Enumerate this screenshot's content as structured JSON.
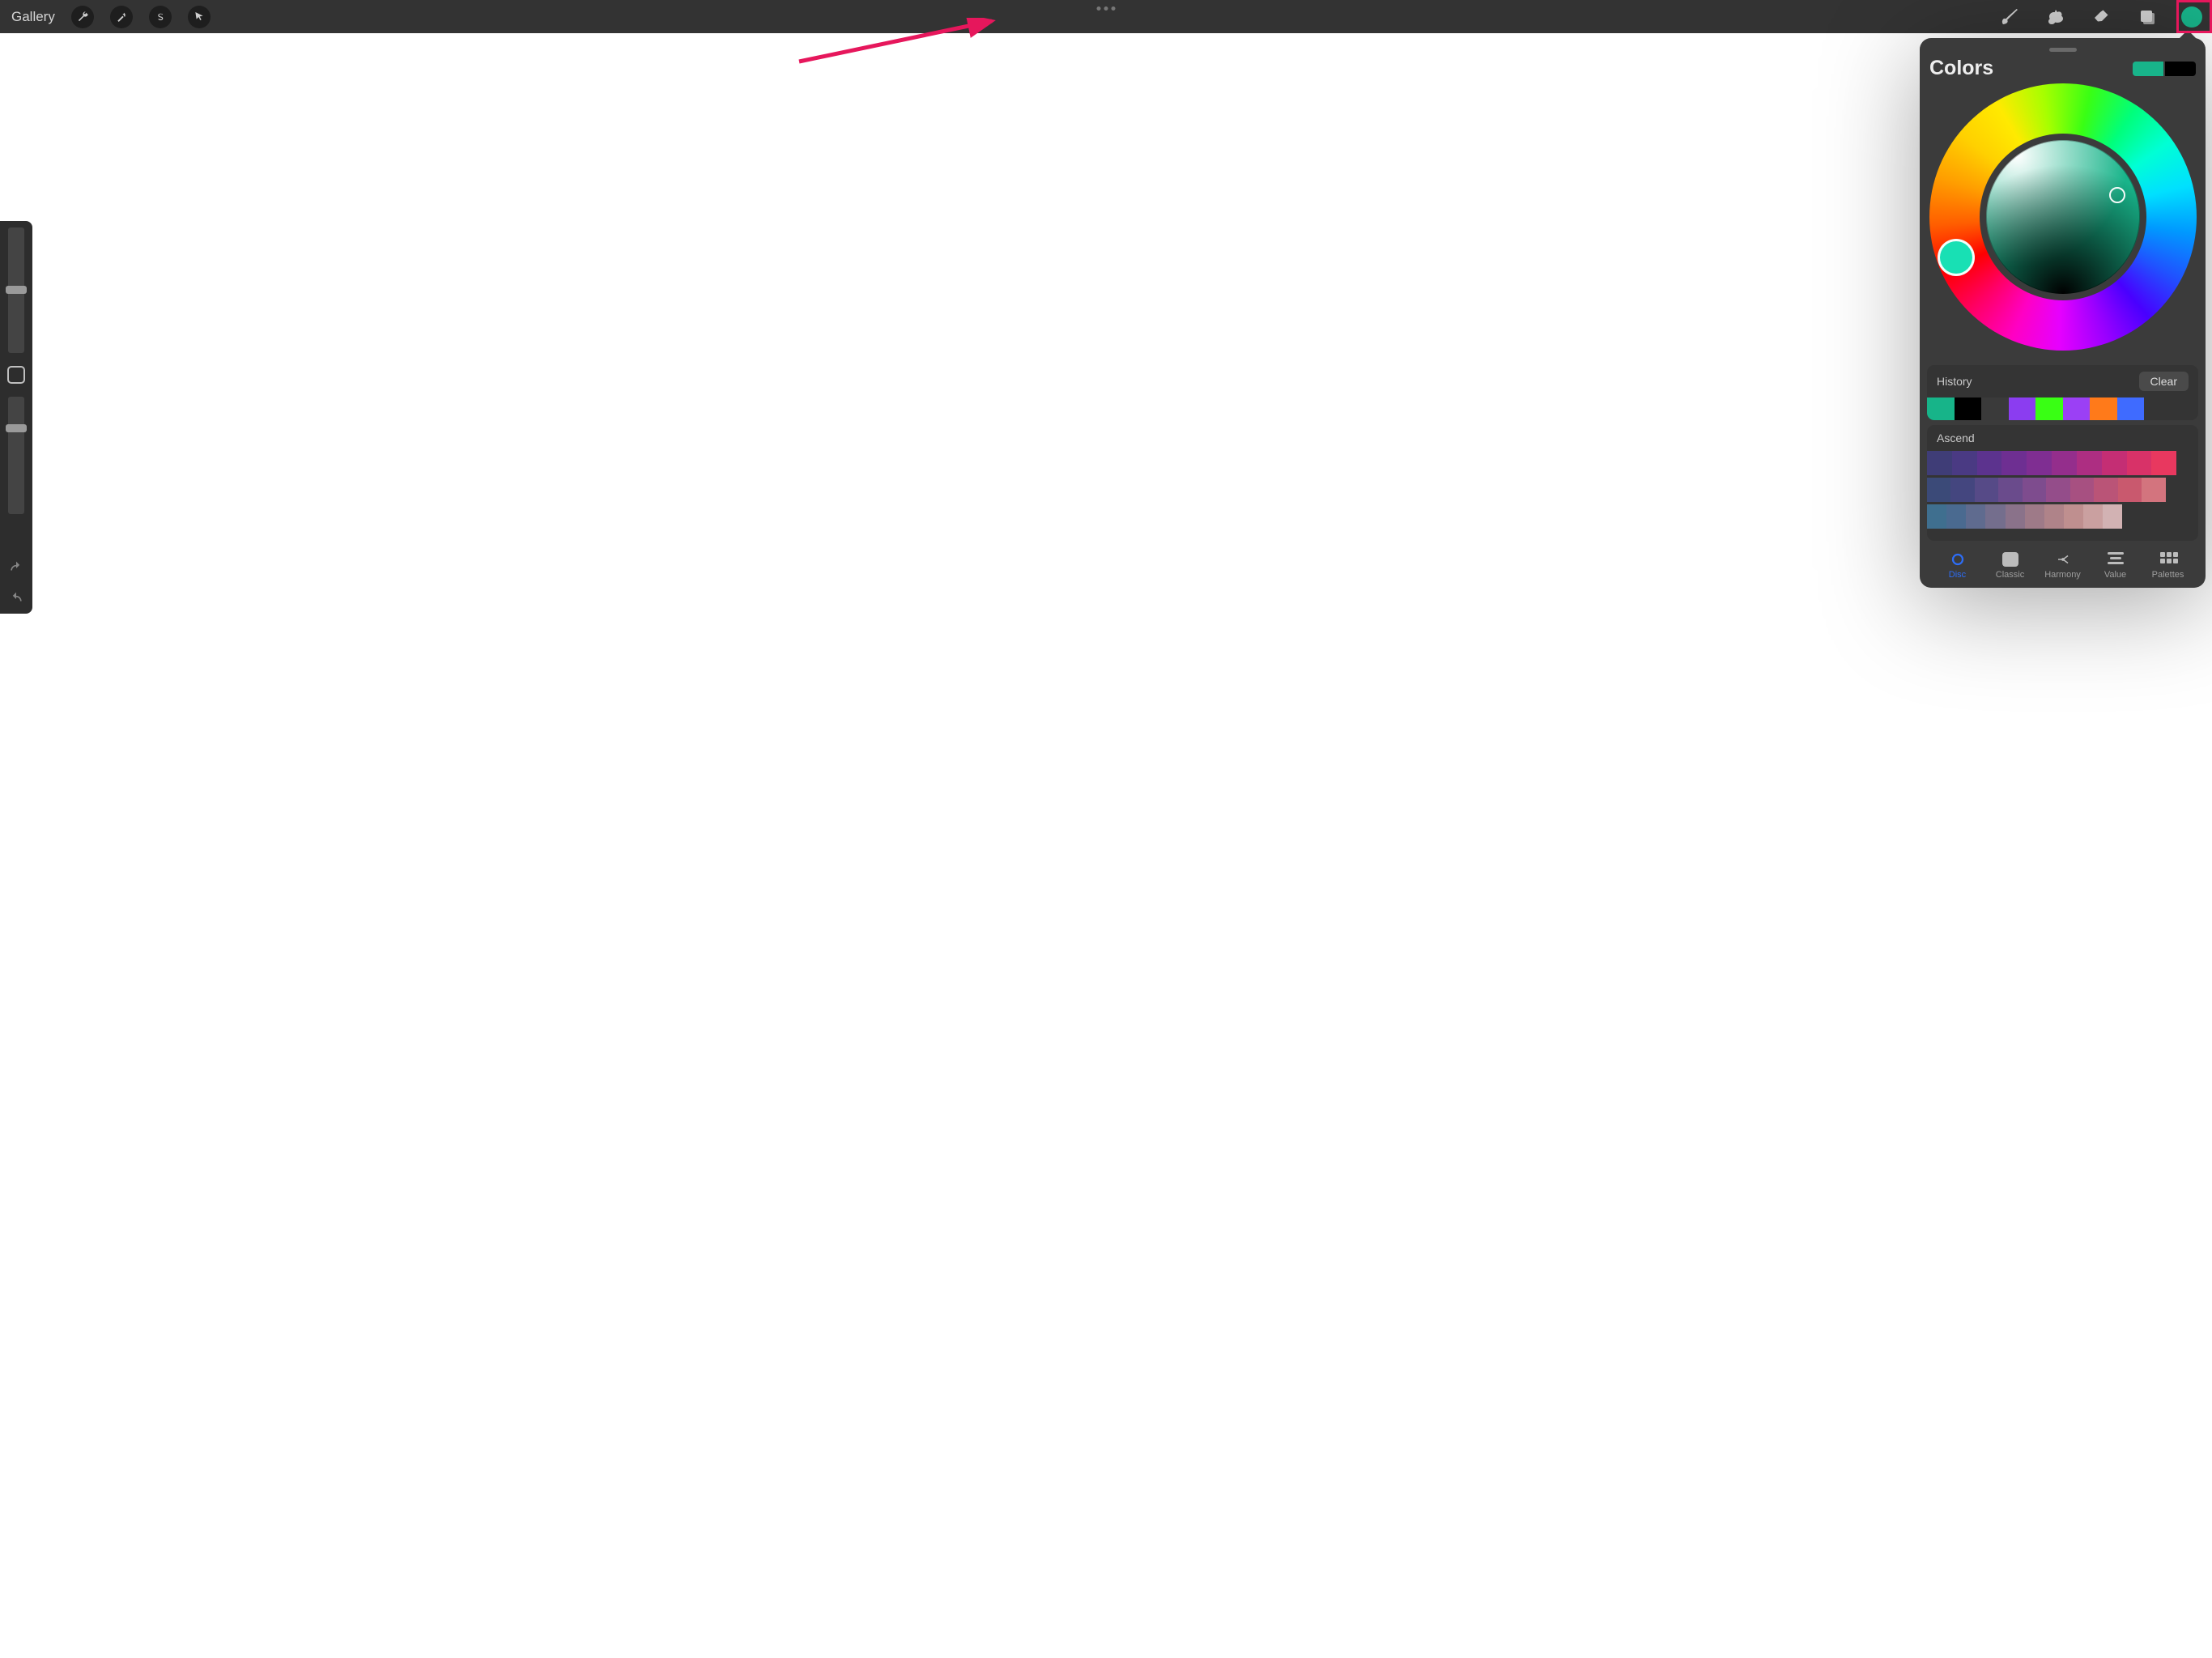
{
  "topbar": {
    "gallery": "Gallery"
  },
  "colors": {
    "title": "Colors",
    "primary": "#18b48a",
    "secondary": "#000000",
    "history_label": "History",
    "clear_label": "Clear",
    "history": [
      "#17b489",
      "#000000",
      "#3a3a3a",
      "#8b3df0",
      "#39ff14",
      "#9b40f5",
      "#ff7a1a",
      "#3f6bff"
    ],
    "palette_name": "Ascend",
    "palette_rows": [
      [
        "#3f3d77",
        "#4a3a83",
        "#5c338e",
        "#6e2f92",
        "#7f2e92",
        "#942e8c",
        "#ad2e82",
        "#c42e74",
        "#d83268",
        "#e8385f"
      ],
      [
        "#3b4a78",
        "#44467f",
        "#564a87",
        "#6a4b8c",
        "#7e4c8e",
        "#944d8a",
        "#a75081",
        "#ba5477",
        "#c9596e",
        "#d3747e"
      ],
      [
        "#3f6f8f",
        "#4a6a90",
        "#5f6b8f",
        "#746e8d",
        "#8a728a",
        "#9e7a88",
        "#af8389",
        "#bf8f8f",
        "#caa0a0",
        "#d2b2b3"
      ]
    ],
    "tabs": {
      "disc": "Disc",
      "classic": "Classic",
      "harmony": "Harmony",
      "value": "Value",
      "palettes": "Palettes"
    }
  }
}
